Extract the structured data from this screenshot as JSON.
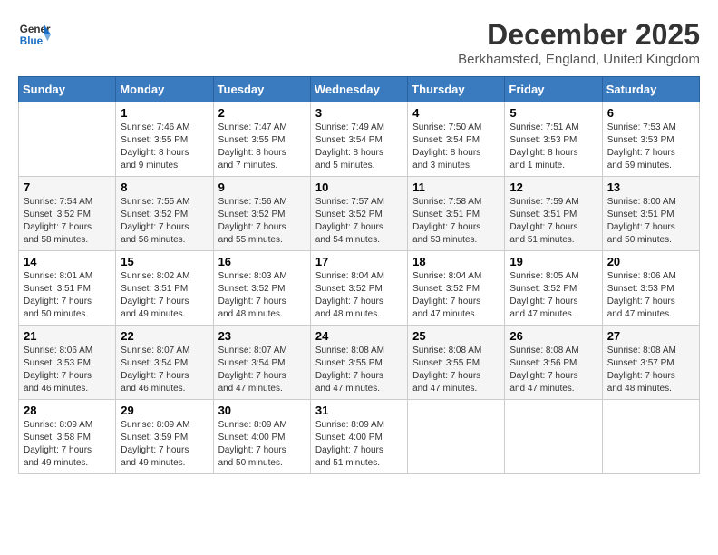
{
  "logo": {
    "line1": "General",
    "line2": "Blue"
  },
  "title": {
    "month_year": "December 2025",
    "location": "Berkhamsted, England, United Kingdom"
  },
  "days_of_week": [
    "Sunday",
    "Monday",
    "Tuesday",
    "Wednesday",
    "Thursday",
    "Friday",
    "Saturday"
  ],
  "weeks": [
    [
      {
        "day": "",
        "info": ""
      },
      {
        "day": "1",
        "info": "Sunrise: 7:46 AM\nSunset: 3:55 PM\nDaylight: 8 hours\nand 9 minutes."
      },
      {
        "day": "2",
        "info": "Sunrise: 7:47 AM\nSunset: 3:55 PM\nDaylight: 8 hours\nand 7 minutes."
      },
      {
        "day": "3",
        "info": "Sunrise: 7:49 AM\nSunset: 3:54 PM\nDaylight: 8 hours\nand 5 minutes."
      },
      {
        "day": "4",
        "info": "Sunrise: 7:50 AM\nSunset: 3:54 PM\nDaylight: 8 hours\nand 3 minutes."
      },
      {
        "day": "5",
        "info": "Sunrise: 7:51 AM\nSunset: 3:53 PM\nDaylight: 8 hours\nand 1 minute."
      },
      {
        "day": "6",
        "info": "Sunrise: 7:53 AM\nSunset: 3:53 PM\nDaylight: 7 hours\nand 59 minutes."
      }
    ],
    [
      {
        "day": "7",
        "info": "Sunrise: 7:54 AM\nSunset: 3:52 PM\nDaylight: 7 hours\nand 58 minutes."
      },
      {
        "day": "8",
        "info": "Sunrise: 7:55 AM\nSunset: 3:52 PM\nDaylight: 7 hours\nand 56 minutes."
      },
      {
        "day": "9",
        "info": "Sunrise: 7:56 AM\nSunset: 3:52 PM\nDaylight: 7 hours\nand 55 minutes."
      },
      {
        "day": "10",
        "info": "Sunrise: 7:57 AM\nSunset: 3:52 PM\nDaylight: 7 hours\nand 54 minutes."
      },
      {
        "day": "11",
        "info": "Sunrise: 7:58 AM\nSunset: 3:51 PM\nDaylight: 7 hours\nand 53 minutes."
      },
      {
        "day": "12",
        "info": "Sunrise: 7:59 AM\nSunset: 3:51 PM\nDaylight: 7 hours\nand 51 minutes."
      },
      {
        "day": "13",
        "info": "Sunrise: 8:00 AM\nSunset: 3:51 PM\nDaylight: 7 hours\nand 50 minutes."
      }
    ],
    [
      {
        "day": "14",
        "info": "Sunrise: 8:01 AM\nSunset: 3:51 PM\nDaylight: 7 hours\nand 50 minutes."
      },
      {
        "day": "15",
        "info": "Sunrise: 8:02 AM\nSunset: 3:51 PM\nDaylight: 7 hours\nand 49 minutes."
      },
      {
        "day": "16",
        "info": "Sunrise: 8:03 AM\nSunset: 3:52 PM\nDaylight: 7 hours\nand 48 minutes."
      },
      {
        "day": "17",
        "info": "Sunrise: 8:04 AM\nSunset: 3:52 PM\nDaylight: 7 hours\nand 48 minutes."
      },
      {
        "day": "18",
        "info": "Sunrise: 8:04 AM\nSunset: 3:52 PM\nDaylight: 7 hours\nand 47 minutes."
      },
      {
        "day": "19",
        "info": "Sunrise: 8:05 AM\nSunset: 3:52 PM\nDaylight: 7 hours\nand 47 minutes."
      },
      {
        "day": "20",
        "info": "Sunrise: 8:06 AM\nSunset: 3:53 PM\nDaylight: 7 hours\nand 47 minutes."
      }
    ],
    [
      {
        "day": "21",
        "info": "Sunrise: 8:06 AM\nSunset: 3:53 PM\nDaylight: 7 hours\nand 46 minutes."
      },
      {
        "day": "22",
        "info": "Sunrise: 8:07 AM\nSunset: 3:54 PM\nDaylight: 7 hours\nand 46 minutes."
      },
      {
        "day": "23",
        "info": "Sunrise: 8:07 AM\nSunset: 3:54 PM\nDaylight: 7 hours\nand 47 minutes."
      },
      {
        "day": "24",
        "info": "Sunrise: 8:08 AM\nSunset: 3:55 PM\nDaylight: 7 hours\nand 47 minutes."
      },
      {
        "day": "25",
        "info": "Sunrise: 8:08 AM\nSunset: 3:55 PM\nDaylight: 7 hours\nand 47 minutes."
      },
      {
        "day": "26",
        "info": "Sunrise: 8:08 AM\nSunset: 3:56 PM\nDaylight: 7 hours\nand 47 minutes."
      },
      {
        "day": "27",
        "info": "Sunrise: 8:08 AM\nSunset: 3:57 PM\nDaylight: 7 hours\nand 48 minutes."
      }
    ],
    [
      {
        "day": "28",
        "info": "Sunrise: 8:09 AM\nSunset: 3:58 PM\nDaylight: 7 hours\nand 49 minutes."
      },
      {
        "day": "29",
        "info": "Sunrise: 8:09 AM\nSunset: 3:59 PM\nDaylight: 7 hours\nand 49 minutes."
      },
      {
        "day": "30",
        "info": "Sunrise: 8:09 AM\nSunset: 4:00 PM\nDaylight: 7 hours\nand 50 minutes."
      },
      {
        "day": "31",
        "info": "Sunrise: 8:09 AM\nSunset: 4:00 PM\nDaylight: 7 hours\nand 51 minutes."
      },
      {
        "day": "",
        "info": ""
      },
      {
        "day": "",
        "info": ""
      },
      {
        "day": "",
        "info": ""
      }
    ]
  ]
}
